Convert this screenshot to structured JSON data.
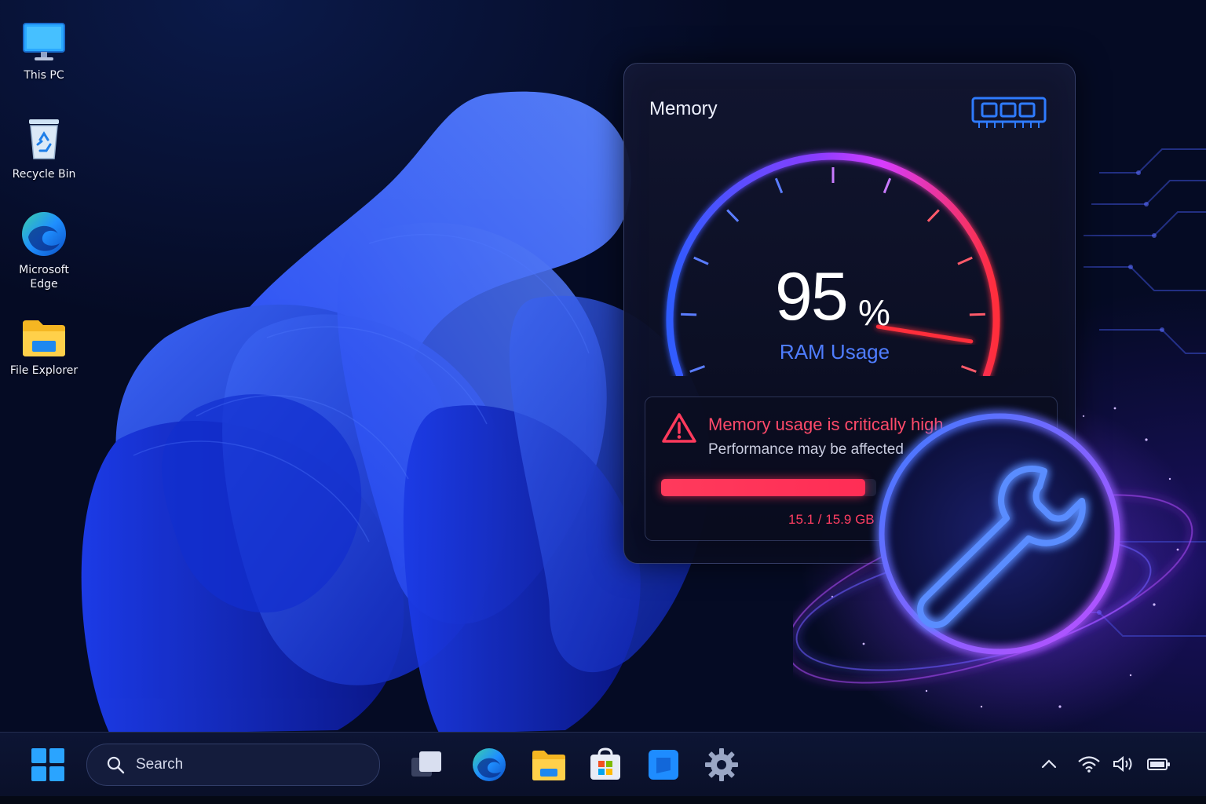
{
  "desktop": {
    "icons": [
      {
        "label": "This PC",
        "icon": "monitor-icon"
      },
      {
        "label": "Recycle Bin",
        "icon": "recycle-bin-icon"
      },
      {
        "label": "Microsoft\nEdge",
        "label_line1": "Microsoft",
        "label_line2": "Edge",
        "icon": "edge-icon"
      },
      {
        "label": "File Explorer",
        "icon": "folder-icon"
      }
    ]
  },
  "memory_widget": {
    "title": "Memory",
    "percent": "95",
    "percent_sign": "%",
    "gauge_value_fraction": 0.95,
    "metric_label": "RAM Usage",
    "alert_title": "Memory usage is critically high",
    "alert_subtitle": "Performance may be affected",
    "usage_text": "15.1 / 15.9 GB",
    "used_fraction": 0.95,
    "icons": [
      "ram-module-icon",
      "warning-icon",
      "wrench-icon"
    ]
  },
  "taskbar": {
    "search_placeholder": "Search",
    "apps": [
      "task-view-icon",
      "edge-icon",
      "file-explorer-icon",
      "store-icon",
      "blue-app-icon",
      "settings-icon"
    ],
    "tray": [
      "chevron-up-icon",
      "wifi-icon",
      "volume-icon",
      "battery-icon"
    ]
  },
  "colors": {
    "accent_blue": "#2f6bff",
    "critical_red": "#ff2d55",
    "label_blue": "#4f7dff",
    "neon_purple": "#a855f7"
  }
}
